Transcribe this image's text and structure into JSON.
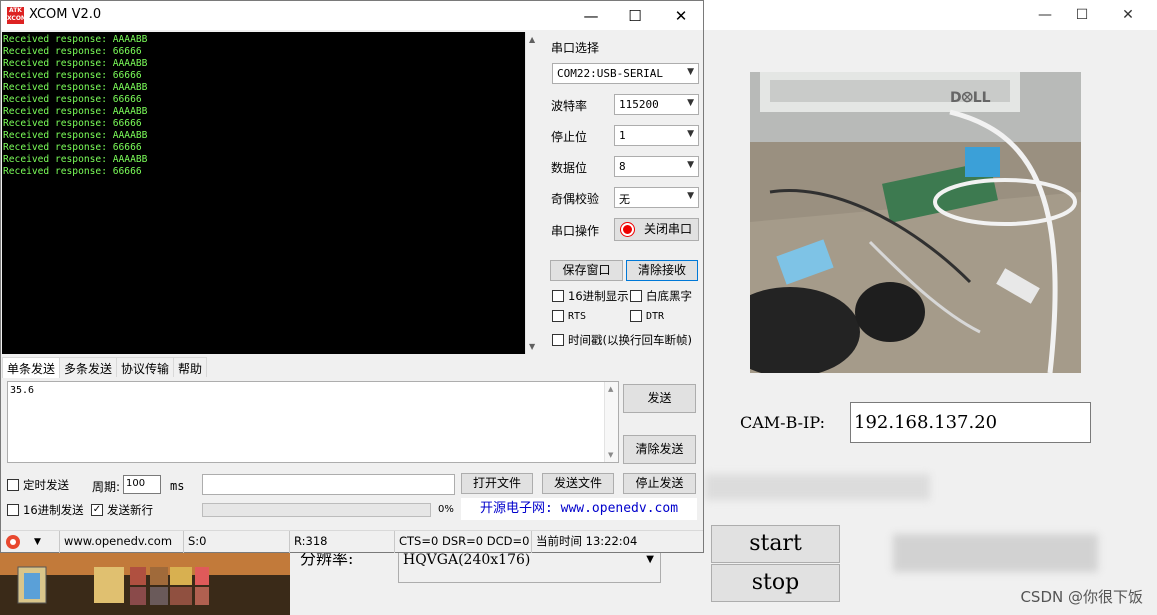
{
  "background_app": {
    "cam_label": "CAM-B-IP:",
    "cam_ip": "192.168.137.20",
    "start_label": "start",
    "stop_label": "stop",
    "resolution_label": "分辨率:",
    "resolution_value": "HQVGA(240x176)",
    "watermark": "CSDN @你很下饭",
    "window_controls": {
      "minimize": "—",
      "maximize": "☐",
      "close": "✕"
    }
  },
  "xcom": {
    "title": "XCOM V2.0",
    "logo_text": "ATK XCOM",
    "window_controls": {
      "minimize": "—",
      "maximize": "☐",
      "close": "✕"
    },
    "receive_lines": [
      "Received response: AAAABB",
      "Received response: 66666",
      "Received response: AAAABB",
      "Received response: 66666",
      "Received response: AAAABB",
      "Received response: 66666",
      "Received response: AAAABB",
      "Received response: 66666",
      "Received response: AAAABB",
      "Received response: 66666",
      "Received response: AAAABB",
      "Received response: 66666"
    ],
    "port_select_label": "串口选择",
    "port_value": "COM22:USB-SERIAL",
    "baud_label": "波特率",
    "baud_value": "115200",
    "stopbits_label": "停止位",
    "stopbits_value": "1",
    "databits_label": "数据位",
    "databits_value": "8",
    "parity_label": "奇偶校验",
    "parity_value": "无",
    "port_op_label": "串口操作",
    "close_port_label": "关闭串口",
    "save_window_label": "保存窗口",
    "clear_recv_label": "清除接收",
    "hex_display_label": "16进制显示",
    "white_bg_label": "白底黑字",
    "rts_label": "RTS",
    "dtr_label": "DTR",
    "timestamp_label": "时间戳(以换行回车断帧)",
    "tabs": [
      "单条发送",
      "多条发送",
      "协议传输",
      "帮助"
    ],
    "send_text": "35.6",
    "send_label": "发送",
    "clear_send_label": "清除发送",
    "timed_send_label": "定时发送",
    "period_label": "周期:",
    "period_value": "100",
    "period_unit": "ms",
    "open_file_label": "打开文件",
    "send_file_label": "发送文件",
    "stop_send_label": "停止发送",
    "hex_send_label": "16进制发送",
    "send_newline_label": "发送新行",
    "send_newline_checked": true,
    "progress_text": "0%",
    "progress_fraction": 0.0,
    "ad_text": "开源电子网: www.openedv.com",
    "status": {
      "url": "www.openedv.com",
      "sent": "S:0",
      "received": "R:318",
      "lines": "CTS=0 DSR=0 DCD=0",
      "time": "当前时间 13:22:04"
    }
  }
}
